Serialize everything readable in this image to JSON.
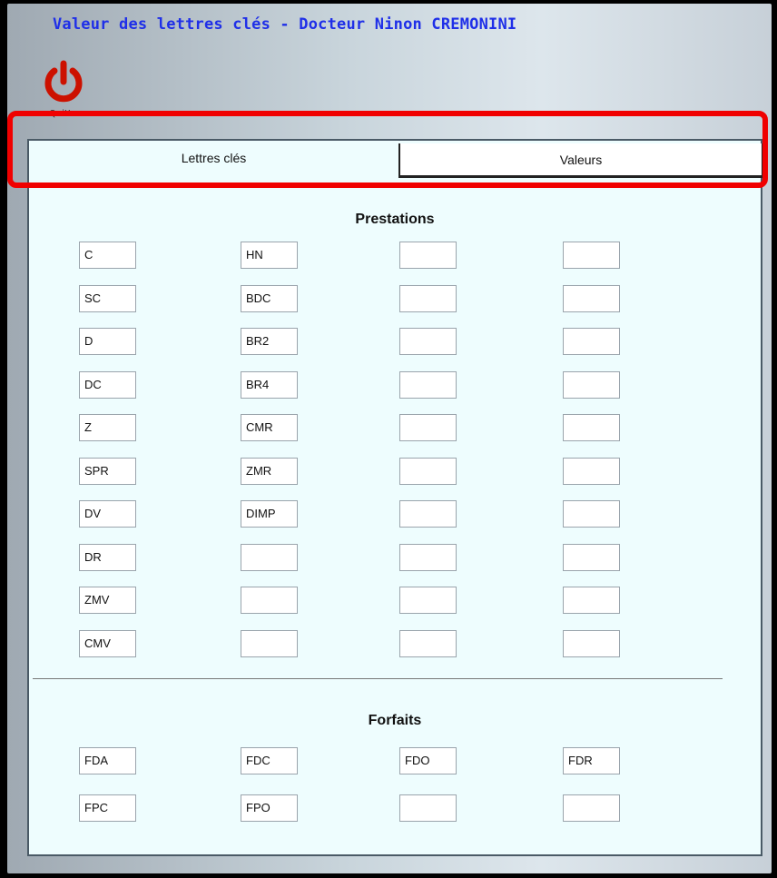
{
  "window": {
    "title": "Valeur des lettres clés - Docteur Ninon CREMONINI"
  },
  "toolbar": {
    "quit_label": "Quitter"
  },
  "tabs": [
    {
      "label": "Lettres clés"
    },
    {
      "label": "Valeurs"
    }
  ],
  "prestations": {
    "title": "Prestations",
    "columns": [
      [
        "C",
        "SC",
        "D",
        "DC",
        "Z",
        "SPR",
        "DV",
        "DR",
        "ZMV",
        "CMV"
      ],
      [
        "HN",
        "BDC",
        "BR2",
        "BR4",
        "CMR",
        "ZMR",
        "DIMP",
        "",
        "",
        ""
      ],
      [
        "",
        "",
        "",
        "",
        "",
        "",
        "",
        "",
        "",
        ""
      ],
      [
        "",
        "",
        "",
        "",
        "",
        "",
        "",
        "",
        "",
        ""
      ]
    ]
  },
  "forfaits": {
    "title": "Forfaits",
    "columns": [
      [
        "FDA",
        "FPC"
      ],
      [
        "FDC",
        "FPO"
      ],
      [
        "FDO",
        ""
      ],
      [
        "FDR",
        ""
      ]
    ]
  },
  "colors": {
    "title": "#1f2fe8",
    "quit_icon": "#cc1100",
    "highlight": "#f00000",
    "panel": "#eefdfe"
  },
  "icons": {
    "quit": "power-icon"
  }
}
